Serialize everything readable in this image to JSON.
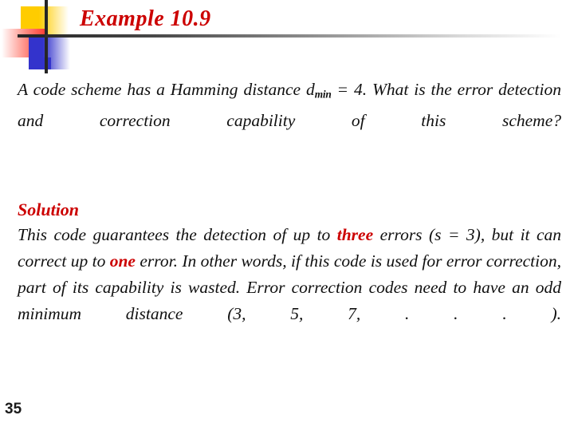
{
  "slide": {
    "title": "Example 10.9",
    "title_color": "#CC0000",
    "page_number": "35",
    "background_color": "#FFFFFF"
  },
  "logo": {
    "yellow": "#FFCC00",
    "red": "#FF3B30",
    "blue": "#3333CC",
    "cross_color": "#262626"
  },
  "question": {
    "part1": "A code scheme has a Hamming distance d",
    "subscript": "min",
    "part2": " = 4. What is the error detection and correction capability of this scheme?"
  },
  "solution": {
    "heading": "Solution",
    "heading_color": "#CC0000",
    "seg1": "This code guarantees the detection of up to ",
    "emph1": "three",
    "seg2": " errors (s = 3), but it can correct up to ",
    "emph2": "one",
    "seg3": " error. In other words, if this code is used for error correction, part of its capability is wasted. Error correction codes need to have an odd minimum distance (3, 5, 7, . . . )."
  }
}
